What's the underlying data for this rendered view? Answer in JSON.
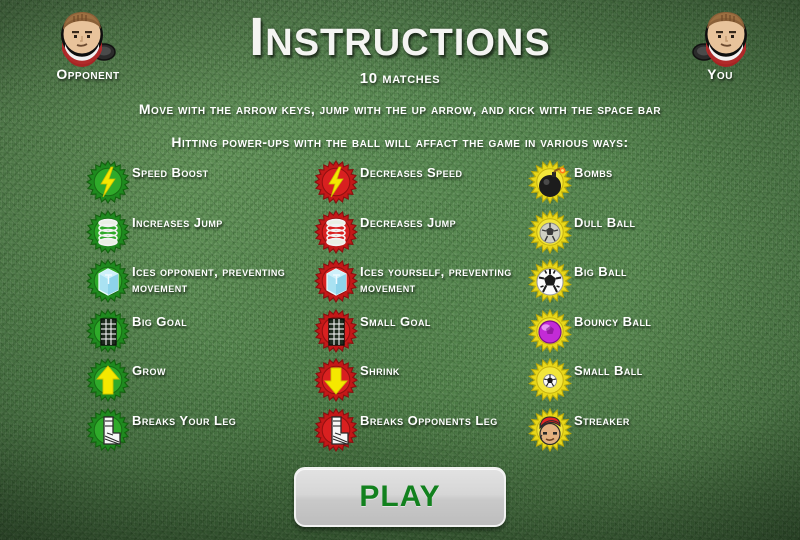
{
  "header": {
    "title": "Instructions",
    "subtitle": "10 matches"
  },
  "players": {
    "opponent": {
      "name": "Opponent",
      "avatar_icon": "player-head-icon"
    },
    "you": {
      "name": "You",
      "avatar_icon": "player-head-icon"
    }
  },
  "instructions": {
    "line1": "Move with the arrow keys, jump with the up arrow, and kick with the space bar",
    "line2": "Hitting power-ups with the ball will affact the game in various ways:"
  },
  "colors": {
    "grass": "#55874f",
    "grass_dark": "#3d6b3d",
    "badge_green": "#1f8a1f",
    "badge_green_inner": "#2faa2a",
    "badge_red": "#c41818",
    "badge_red_inner": "#d92020",
    "badge_yellow": "#e8d81a",
    "badge_yellow_inner": "#f2e63a",
    "play_text": "#12811e",
    "title_text": "#f4f4f2"
  },
  "powerups": {
    "green_column": [
      {
        "label": "Speed Boost",
        "icon": "lightning-bolt-icon",
        "badge": "green"
      },
      {
        "label": "Increases Jump",
        "icon": "spring-coil-icon",
        "badge": "green"
      },
      {
        "label": "Ices opponent, preventing movement",
        "icon": "ice-cube-icon",
        "badge": "green"
      },
      {
        "label": "Big Goal",
        "icon": "goal-net-icon",
        "badge": "green"
      },
      {
        "label": "Grow",
        "icon": "arrow-up-icon",
        "badge": "green"
      },
      {
        "label": "Breaks Your Leg",
        "icon": "broken-leg-cast-icon",
        "badge": "green"
      }
    ],
    "red_column": [
      {
        "label": "Decreases Speed",
        "icon": "lightning-bolt-icon",
        "badge": "red"
      },
      {
        "label": "Decreases Jump",
        "icon": "spring-coil-icon",
        "badge": "red"
      },
      {
        "label": "Ices yourself, preventing movement",
        "icon": "ice-cube-icon",
        "badge": "red"
      },
      {
        "label": "Small Goal",
        "icon": "goal-net-icon",
        "badge": "red"
      },
      {
        "label": "Shrink",
        "icon": "arrow-down-icon",
        "badge": "red"
      },
      {
        "label": "Breaks Opponents Leg",
        "icon": "broken-leg-cast-icon",
        "badge": "red"
      }
    ],
    "yellow_column": [
      {
        "label": "Bombs",
        "icon": "bomb-icon",
        "badge": "yellow"
      },
      {
        "label": "Dull Ball",
        "icon": "soccer-ball-dull-icon",
        "badge": "yellow"
      },
      {
        "label": "Big Ball",
        "icon": "soccer-ball-big-icon",
        "badge": "yellow"
      },
      {
        "label": "Bouncy Ball",
        "icon": "bouncy-ball-icon",
        "badge": "yellow"
      },
      {
        "label": "Small Ball",
        "icon": "soccer-ball-small-icon",
        "badge": "yellow"
      },
      {
        "label": "Streaker",
        "icon": "streaker-face-icon",
        "badge": "yellow"
      }
    ]
  },
  "play_button": {
    "label": "PLAY"
  }
}
